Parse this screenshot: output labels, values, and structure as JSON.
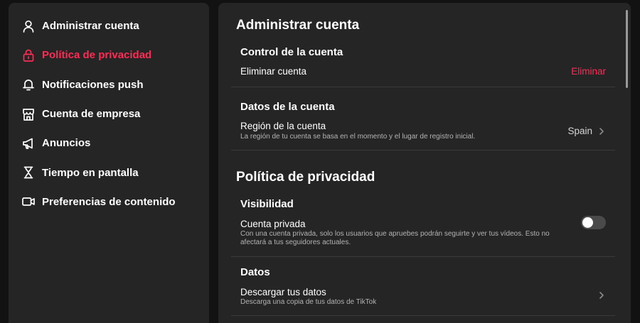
{
  "sidebar": {
    "items": [
      {
        "label": "Administrar cuenta",
        "icon": "user-icon",
        "active": false
      },
      {
        "label": "Política de privacidad",
        "icon": "lock-icon",
        "active": true
      },
      {
        "label": "Notificaciones push",
        "icon": "bell-icon",
        "active": false
      },
      {
        "label": "Cuenta de empresa",
        "icon": "store-icon",
        "active": false
      },
      {
        "label": "Anuncios",
        "icon": "megaphone-icon",
        "active": false
      },
      {
        "label": "Tiempo en pantalla",
        "icon": "hourglass-icon",
        "active": false
      },
      {
        "label": "Preferencias de contenido",
        "icon": "video-icon",
        "active": false
      }
    ]
  },
  "main": {
    "account_section": {
      "title": "Administrar cuenta",
      "control": {
        "title": "Control de la cuenta",
        "delete_label": "Eliminar cuenta",
        "delete_action": "Eliminar"
      },
      "data": {
        "title": "Datos de la cuenta",
        "region_label": "Región de la cuenta",
        "region_desc": "La región de tu cuenta se basa en el momento y el lugar de registro inicial.",
        "region_value": "Spain"
      }
    },
    "privacy_section": {
      "title": "Política de privacidad",
      "visibility": {
        "title": "Visibilidad",
        "private_label": "Cuenta privada",
        "private_desc": "Con una cuenta privada, solo los usuarios que apruebes podrán seguirte y ver tus vídeos. Esto no afectará a tus seguidores actuales.",
        "private_enabled": false
      },
      "data": {
        "title": "Datos",
        "download_label": "Descargar tus datos",
        "download_desc": "Descarga una copia de tus datos de TikTok"
      }
    }
  },
  "colors": {
    "accent": "#fe2c55",
    "panel": "#252525",
    "background": "#121212"
  }
}
